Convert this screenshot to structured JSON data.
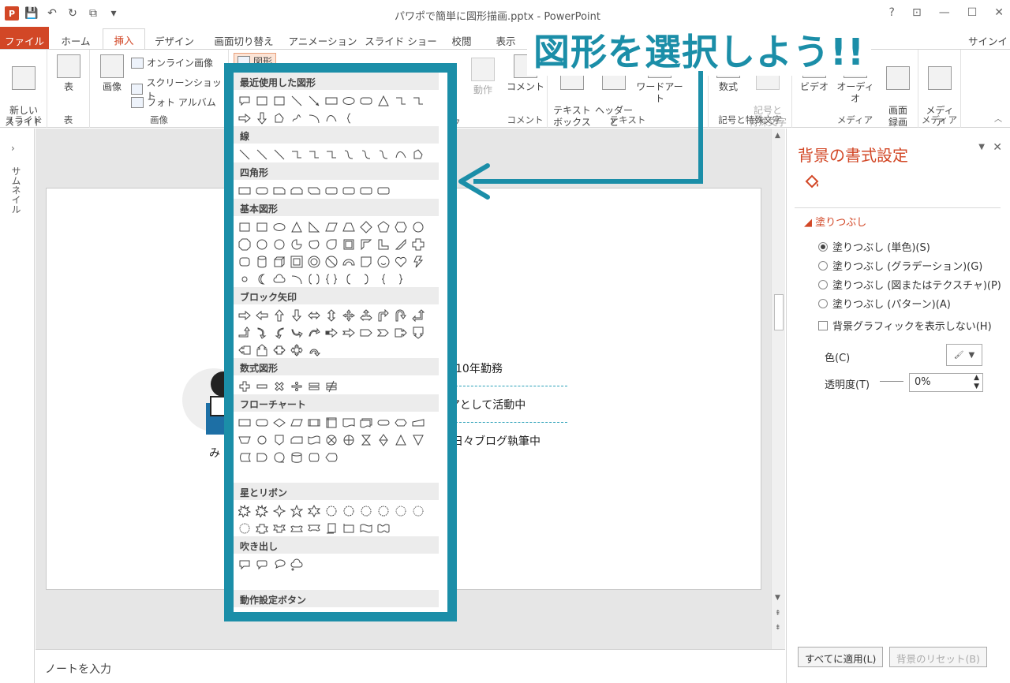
{
  "titlebar": {
    "doc_title": "パワポで簡単に図形描画.pptx - PowerPoint",
    "help": "?",
    "win_minimize": "—",
    "win_restore": "☐",
    "win_close": "✕"
  },
  "tabs": [
    {
      "label": "ファイル"
    },
    {
      "label": "ホーム"
    },
    {
      "label": "挿入"
    },
    {
      "label": "デザイン"
    },
    {
      "label": "画面切り替え"
    },
    {
      "label": "アニメーション"
    },
    {
      "label": "スライド ショー"
    },
    {
      "label": "校閲"
    },
    {
      "label": "表示"
    }
  ],
  "signin": "サインイン",
  "ribbon": {
    "new_slide": "新しい\nスライド",
    "slides_group": "スライド",
    "table": "表",
    "table_group": "表",
    "picture": "画像",
    "online_picture": "オンライン画像",
    "screenshot": "スクリーンショット",
    "photo_album": "フォト アルバム",
    "images_group": "画像",
    "shapes": "図形",
    "action": "動作",
    "links_group": "ク",
    "comment": "コメント",
    "comments_group": "コメント",
    "textbox": "テキスト\nボックス",
    "header_footer": "ヘッダーと\nフッター",
    "wordart": "ワードアート",
    "text_group": "テキスト",
    "equation": "数式",
    "symbol": "記号と\n特殊文字",
    "symbols_group": "記号と特殊文字",
    "video": "ビデオ",
    "audio": "オーディオ",
    "screen_recording": "画面\n録画",
    "media_group": "メディア",
    "insert_media": "メディア\nを挿入",
    "media_group2": "メディア"
  },
  "thumbnail_pane": {
    "label": "サムネイル"
  },
  "slide": {
    "line1": "10年勤務",
    "line2": "アとして活動中",
    "line3": "日々ブログ執筆中",
    "name_fragment": "み"
  },
  "notes": {
    "placeholder": "ノートを入力"
  },
  "format_pane": {
    "title": "背景の書式設定",
    "fill_section": "塗りつぶし",
    "options": [
      {
        "label": "塗りつぶし (単色)(S)",
        "selected": true
      },
      {
        "label": "塗りつぶし (グラデーション)(G)",
        "selected": false
      },
      {
        "label": "塗りつぶし (図またはテクスチャ)(P)",
        "selected": false
      },
      {
        "label": "塗りつぶし (パターン)(A)",
        "selected": false
      }
    ],
    "hide_bg_graphics": "背景グラフィックを表示しない(H)",
    "color_label": "色(C)",
    "transparency_label": "透明度(T)",
    "transparency_value": "0%",
    "apply_all": "すべてに適用(L)",
    "reset_bg": "背景のリセット(B)"
  },
  "gallery": {
    "sections": [
      {
        "title": "最近使用した図形"
      },
      {
        "title": "線"
      },
      {
        "title": "四角形"
      },
      {
        "title": "基本図形"
      },
      {
        "title": "ブロック矢印"
      },
      {
        "title": "数式図形"
      },
      {
        "title": "フローチャート"
      },
      {
        "title": "星とリボン"
      },
      {
        "title": "吹き出し"
      },
      {
        "title": "動作設定ボタン"
      }
    ]
  },
  "callout": {
    "text": "図形を選択しよう!!"
  },
  "colors": {
    "accent": "#d24726",
    "annotation": "#1b8ea8"
  }
}
